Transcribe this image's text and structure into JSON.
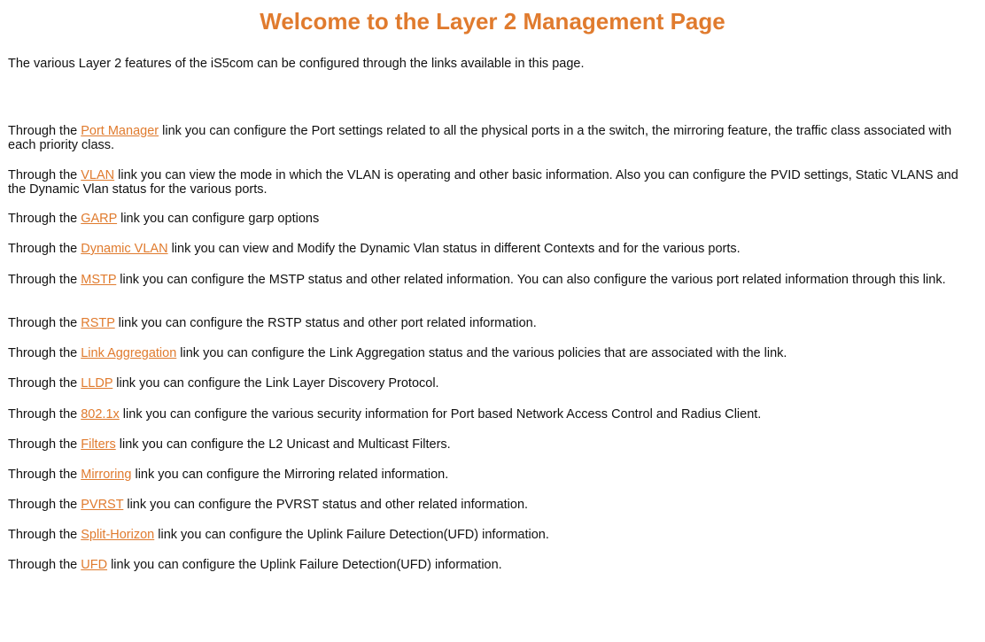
{
  "header": {
    "title": "Welcome to the Layer 2 Management Page"
  },
  "intro": "The various Layer 2 features of the iS5com can be configured through the links available in this page.",
  "items": [
    {
      "prefix": "Through the ",
      "link": "Port Manager",
      "suffix": " link you can configure the Port settings related to all the physical ports in a the switch, the mirroring feature, the traffic class associated with each priority class."
    },
    {
      "prefix": "Through the ",
      "link": "VLAN",
      "suffix": " link you can view the mode in which the VLAN is operating and other basic information. Also you can configure the PVID settings, Static VLANS and the Dynamic Vlan status for the various ports."
    },
    {
      "prefix": "Through the ",
      "link": "GARP",
      "suffix": " link you can configure garp options"
    },
    {
      "prefix": "Through the ",
      "link": "Dynamic VLAN",
      "suffix": " link you can view and Modify the Dynamic Vlan status in different Contexts and for the various ports."
    },
    {
      "prefix": "Through the ",
      "link": "MSTP",
      "suffix": " link you can configure the MSTP status and other related information. You can also configure the various port related information through this link."
    },
    {
      "prefix": "Through the ",
      "link": "RSTP",
      "suffix": " link you can configure the RSTP status and other port related information."
    },
    {
      "prefix": "Through the ",
      "link": "Link Aggregation",
      "suffix": " link you can configure the Link Aggregation status and the various policies that are associated with the link."
    },
    {
      "prefix": "Through the ",
      "link": "LLDP",
      "suffix": " link you can configure the Link Layer Discovery Protocol."
    },
    {
      "prefix": "Through the ",
      "link": "802.1x",
      "suffix": " link you can configure the various security information for Port based Network Access Control and Radius Client."
    },
    {
      "prefix": "Through the ",
      "link": "Filters",
      "suffix": " link you can configure the L2 Unicast and Multicast Filters."
    },
    {
      "prefix": "Through the ",
      "link": "Mirroring",
      "suffix": " link you can configure the Mirroring related information."
    },
    {
      "prefix": "Through the ",
      "link": "PVRST",
      "suffix": " link you can configure the PVRST status and other related information."
    },
    {
      "prefix": "Through the ",
      "link": "Split-Horizon",
      "suffix": " link you can configure the Uplink Failure Detection(UFD) information."
    },
    {
      "prefix": "Through the ",
      "link": "UFD",
      "suffix": " link you can configure the Uplink Failure Detection(UFD) information."
    }
  ],
  "colors": {
    "accent": "#e07b2e",
    "text": "#111111",
    "background": "#ffffff"
  }
}
